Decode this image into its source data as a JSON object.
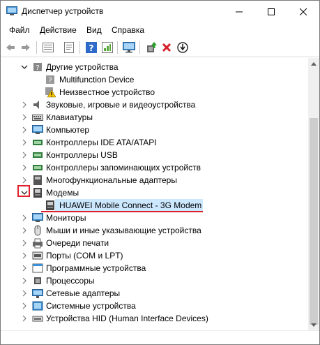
{
  "window": {
    "title": "Диспетчер устройств"
  },
  "menu": [
    "Файл",
    "Действие",
    "Вид",
    "Справка"
  ],
  "toolbar": {
    "buttons": [
      "back-icon",
      "forward-icon",
      "device-list-icon",
      "properties-icon",
      "help-icon",
      "resources-icon",
      "monitor-icon",
      "update-driver-icon",
      "uninstall-icon",
      "download-icon"
    ]
  },
  "tree": {
    "rows": [
      {
        "label": "Другие устройства",
        "expanded": true,
        "icon": "other-devices-icon"
      },
      {
        "label": "Multifunction Device",
        "icon": "unknown-device-icon"
      },
      {
        "label": "Неизвестное устройство",
        "icon": "warning-device-icon"
      },
      {
        "label": "Звуковые, игровые и видеоустройства",
        "icon": "sound-icon"
      },
      {
        "label": "Клавиатуры",
        "icon": "keyboard-icon"
      },
      {
        "label": "Компьютер",
        "icon": "computer-icon"
      },
      {
        "label": "Контроллеры IDE ATA/ATAPI",
        "icon": "ide-controller-icon"
      },
      {
        "label": "Контроллеры USB",
        "icon": "usb-icon"
      },
      {
        "label": "Контроллеры запоминающих устройств",
        "icon": "storage-controller-icon"
      },
      {
        "label": "Многофункциональные адаптеры",
        "icon": "multifunction-adapter-icon"
      },
      {
        "label": "Модемы",
        "expanded": true,
        "icon": "modem-icon"
      },
      {
        "label": "HUAWEI Mobile Connect - 3G Modem",
        "selected": true,
        "icon": "modem-icon"
      },
      {
        "label": "Мониторы",
        "icon": "monitor-icon"
      },
      {
        "label": "Мыши и иные указывающие устройства",
        "icon": "mouse-icon"
      },
      {
        "label": "Очереди печати",
        "icon": "print-queue-icon"
      },
      {
        "label": "Порты (COM и LPT)",
        "icon": "ports-icon"
      },
      {
        "label": "Программные устройства",
        "icon": "software-device-icon"
      },
      {
        "label": "Процессоры",
        "icon": "processor-icon"
      },
      {
        "label": "Сетевые адаптеры",
        "icon": "network-adapter-icon"
      },
      {
        "label": "Системные устройства",
        "icon": "system-device-icon"
      },
      {
        "label": "Устройства HID (Human Interface Devices)",
        "icon": "hid-icon"
      }
    ]
  },
  "colors": {
    "selection": "#cce8ff",
    "highlight": "#e0202b"
  }
}
